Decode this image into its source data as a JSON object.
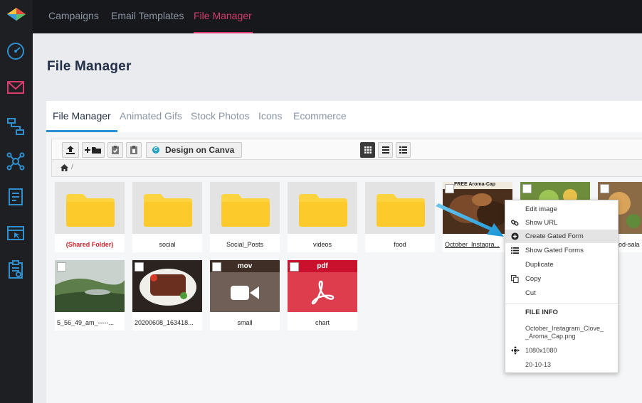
{
  "rail": {
    "icons": [
      "app-logo",
      "dashboard-icon",
      "campaign-mail-icon",
      "automation-flow-icon",
      "network-icon",
      "report-icon",
      "browser-window-icon",
      "clipboard-icon"
    ]
  },
  "topnav": {
    "tabs": [
      {
        "label": "Campaigns"
      },
      {
        "label": "Email Templates"
      },
      {
        "label": "File Manager"
      }
    ],
    "active": "File Manager"
  },
  "page": {
    "title": "File Manager"
  },
  "subtabs": [
    {
      "label": "File Manager"
    },
    {
      "label": "Animated Gifs"
    },
    {
      "label": "Stock Photos"
    },
    {
      "label": "Icons"
    },
    {
      "label": "Ecommerce"
    }
  ],
  "toolbar": {
    "canva_label": "Design on Canva",
    "canva_icon_letter": "C",
    "buttons": [
      "upload-icon",
      "new-folder-icon",
      "paste-icon",
      "delete-clipboard-icon"
    ],
    "views": [
      "grid-view-icon",
      "list-view-icon",
      "detail-view-icon"
    ]
  },
  "breadcrumb": {
    "separator": "/"
  },
  "tiles": [
    {
      "name": "(Shared Folder)",
      "kind": "folder"
    },
    {
      "name": "social",
      "kind": "folder"
    },
    {
      "name": "Social_Posts",
      "kind": "folder"
    },
    {
      "name": "videos",
      "kind": "folder"
    },
    {
      "name": "food",
      "kind": "folder"
    },
    {
      "name": "October_Instagra...",
      "kind": "image",
      "overlay_text": "FREE Aroma-Cap"
    },
    {
      "name": "",
      "kind": "image"
    },
    {
      "name": "od-salad",
      "kind": "image"
    },
    {
      "name": "5_56_49_am_-----...",
      "kind": "image"
    },
    {
      "name": "20200608_163418...",
      "kind": "image"
    },
    {
      "name": "small",
      "kind": "video",
      "badge": "mov"
    },
    {
      "name": "chart",
      "kind": "pdf",
      "badge": "pdf"
    }
  ],
  "context_menu": {
    "items": [
      {
        "label": "Edit image",
        "icon": ""
      },
      {
        "label": "Show URL",
        "icon": "link-icon"
      },
      {
        "label": "Create Gated Form",
        "icon": "plus-circle-icon",
        "highlighted": true
      },
      {
        "label": "Show Gated Forms",
        "icon": "list-icon"
      },
      {
        "label": "Duplicate",
        "icon": ""
      },
      {
        "label": "Copy",
        "icon": "copy-icon"
      },
      {
        "label": "Cut",
        "icon": ""
      }
    ],
    "info_heading": "FILE INFO",
    "info_filename_line1": "October_Instagram_Clove_",
    "info_filename_line2": "_Aroma_Cap.png",
    "info_dimensions": "1080x1080",
    "info_date": "20-10-13"
  },
  "colors": {
    "accent": "#d63b6c",
    "tab_underline": "#2b8fd6",
    "folder": "#fdd440",
    "pdf": "#c9102c",
    "video": "#6f5f57",
    "arrow": "#2aa7e3"
  }
}
